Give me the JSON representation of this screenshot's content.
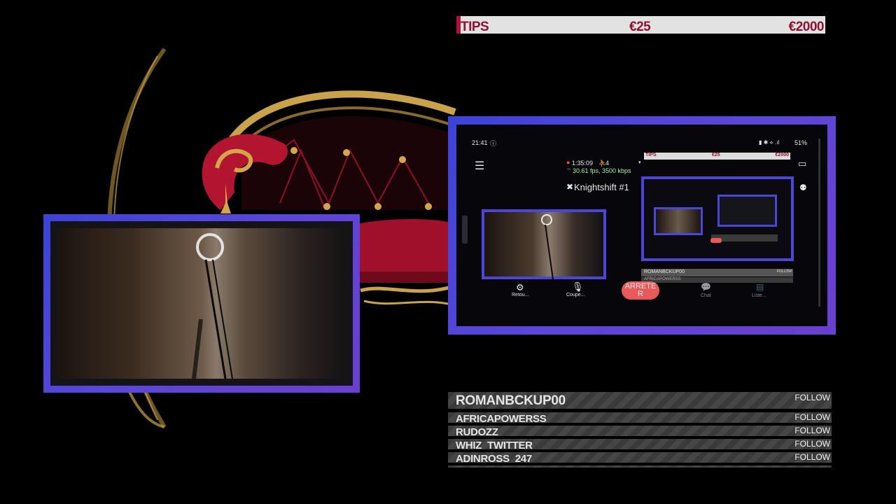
{
  "tips": {
    "label": "TIPS",
    "amount1": "€25",
    "amount2": "€2000"
  },
  "phone": {
    "time": "21:41",
    "battery": "51%",
    "stream_time": "1:35:09",
    "viewers": "4",
    "fps_line": "30.61 fps, 3500 kbps",
    "stream_title": "Knightshift #1",
    "inner_tips": {
      "label": "TIPS",
      "amount1": "€25",
      "amount2": "€2000"
    },
    "buttons": {
      "back": "Retou...",
      "mute": "Coupe...",
      "stop": "ARRETER",
      "chat": "Chat",
      "list": "Liste..."
    },
    "inner_follow": {
      "name": "ROMANBCKUP00",
      "action": "FOLLOW",
      "name2": "AFRICAPOWERSS"
    }
  },
  "follow_list": {
    "rows": [
      {
        "name": "ROMANBCKUP00",
        "action": "FOLLOW"
      },
      {
        "name": "AFRICAPOWERSS",
        "action": "FOLLOW"
      },
      {
        "name": "RUDOZZ",
        "action": "FOLLOW"
      },
      {
        "name": "WHIZ_TWITTER",
        "action": "FOLLOW"
      },
      {
        "name": "ADINROSS_247",
        "action": "FOLLOW"
      }
    ]
  },
  "colors": {
    "frame": "#4f46d8",
    "tips_accent": "#b1123b",
    "tips_text": "#8e1233",
    "stop_button": "#e85a5a"
  }
}
